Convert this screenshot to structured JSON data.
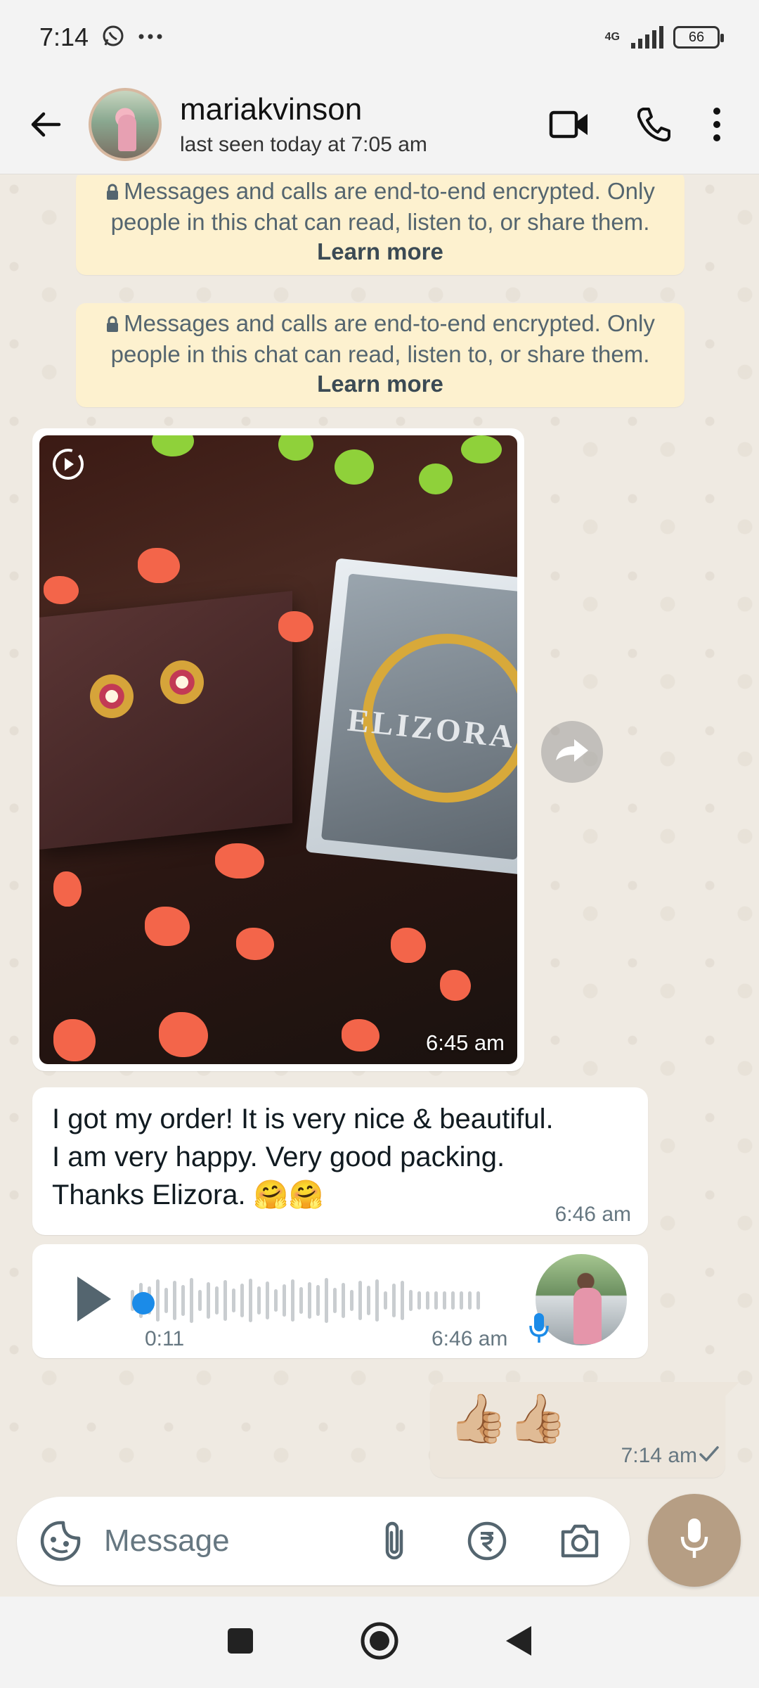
{
  "status_bar": {
    "time": "7:14",
    "notification_icons": [
      "whatsapp-icon",
      "more-dots-icon"
    ],
    "network": "4G",
    "battery": "66"
  },
  "header": {
    "contact_name": "mariakvinson",
    "last_seen": "last seen today at 7:05 am",
    "icons": [
      "back-arrow-icon",
      "video-call-icon",
      "voice-call-icon",
      "more-vert-icon"
    ]
  },
  "chat": {
    "system_messages": [
      {
        "text": "Messages and calls are end-to-end encrypted. Only people in this chat can read, listen to, or share them.",
        "link": "Learn more"
      },
      {
        "text": "Messages and calls are end-to-end encrypted. Only people in this chat can read, listen to, or share them.",
        "link": "Learn more"
      }
    ],
    "image_message": {
      "time": "6:45 am",
      "view_once_icon": "timer-icon",
      "photo_brand_text": "ELIZORA"
    },
    "text_message": {
      "text": "I got my order! It is very nice & beautiful.\nI am very happy. Very good packing.\nThanks Elizora. 🤗🤗",
      "time": "6:46 am"
    },
    "voice_message": {
      "duration": "0:11",
      "time": "6:46 am",
      "progress": 0
    },
    "outgoing_message": {
      "emoji": "👍🏼👍🏼",
      "time": "7:14 am",
      "status": "sent"
    }
  },
  "composer": {
    "placeholder": "Message",
    "icons": [
      "sticker-icon",
      "attach-icon",
      "rupee-payment-icon",
      "camera-icon",
      "mic-icon"
    ]
  },
  "colors": {
    "chat_background": "#efeae2",
    "system_bubble": "#fdf1cf",
    "incoming_bubble": "#ffffff",
    "outgoing_bubble": "#ede6dc",
    "mic_button": "#b69e84",
    "voice_progress_dot": "#1b8be8"
  }
}
